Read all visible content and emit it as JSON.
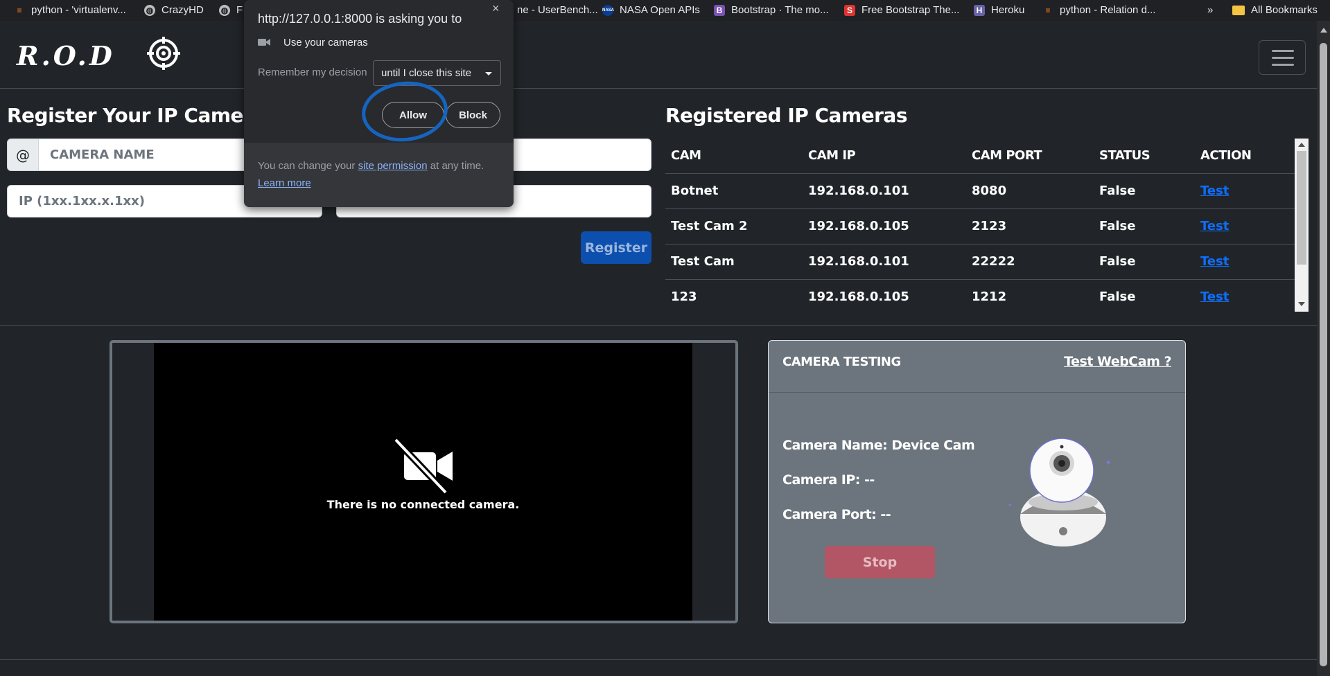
{
  "bookmarks": [
    {
      "label": "python - 'virtualenv...",
      "icon": "stackoverflow-icon",
      "color": "#f48024"
    },
    {
      "label": "CrazyHD",
      "icon": "globe-icon",
      "color": "#bdbdbd"
    },
    {
      "label": "F",
      "icon": "globe-icon",
      "color": "#bdbdbd"
    },
    {
      "label": "ne - UserBench...",
      "icon": "",
      "color": ""
    },
    {
      "label": "NASA Open APIs",
      "icon": "nasa-icon",
      "color": "#0b3d91"
    },
    {
      "label": "Bootstrap · The mo...",
      "icon": "bootstrap-icon",
      "color": "#7952b3"
    },
    {
      "label": "Free Bootstrap The...",
      "icon": "startbootstrap-icon",
      "color": "#dd3333"
    },
    {
      "label": "Heroku",
      "icon": "heroku-icon",
      "color": "#6762a6"
    },
    {
      "label": "python - Relation d...",
      "icon": "stackoverflow-icon",
      "color": "#f48024"
    }
  ],
  "bookmarks_more": "»",
  "all_bookmarks": "All Bookmarks",
  "brand": {
    "text": "R.O.D"
  },
  "register": {
    "title": "Register Your IP Camera",
    "at_symbol": "@",
    "camera_name_placeholder": "CAMERA NAME",
    "ip_placeholder": "IP (1xx.1xx.x.1xx)",
    "register_label": "Register"
  },
  "registered": {
    "title": "Registered IP Cameras",
    "columns": [
      "CAM",
      "CAM IP",
      "CAM PORT",
      "STATUS",
      "ACTION"
    ],
    "rows": [
      {
        "cam": "Botnet",
        "ip": "192.168.0.101",
        "port": "8080",
        "status": "False",
        "action": "Test"
      },
      {
        "cam": "Test Cam 2",
        "ip": "192.168.0.105",
        "port": "2123",
        "status": "False",
        "action": "Test"
      },
      {
        "cam": "Test Cam",
        "ip": "192.168.0.101",
        "port": "22222",
        "status": "False",
        "action": "Test"
      },
      {
        "cam": "123",
        "ip": "192.168.0.105",
        "port": "1212",
        "status": "False",
        "action": "Test"
      }
    ]
  },
  "video": {
    "message": "There is no connected camera."
  },
  "testing": {
    "title": "CAMERA TESTING",
    "link": "Test WebCam ?",
    "name_line": "Camera Name: Device Cam",
    "ip_line": "Camera IP: --",
    "port_line": "Camera Port: --",
    "stop_label": "Stop"
  },
  "popup": {
    "title": "http://127.0.0.1:8000 is asking you to",
    "close": "×",
    "permission": "Use your cameras",
    "remember_label": "Remember my decision",
    "remember_value": "until I close this site",
    "allow_label": "Allow",
    "block_label": "Block",
    "footer_prefix": "You can change your ",
    "footer_link": "site permission",
    "footer_suffix": " at any time.",
    "learn_more": "Learn more"
  },
  "colors": {
    "page_bg": "#212529",
    "primary": "#0d6efd",
    "danger": "#dc3545",
    "card_bg": "#6c757d",
    "annotation": "#1565c0"
  }
}
